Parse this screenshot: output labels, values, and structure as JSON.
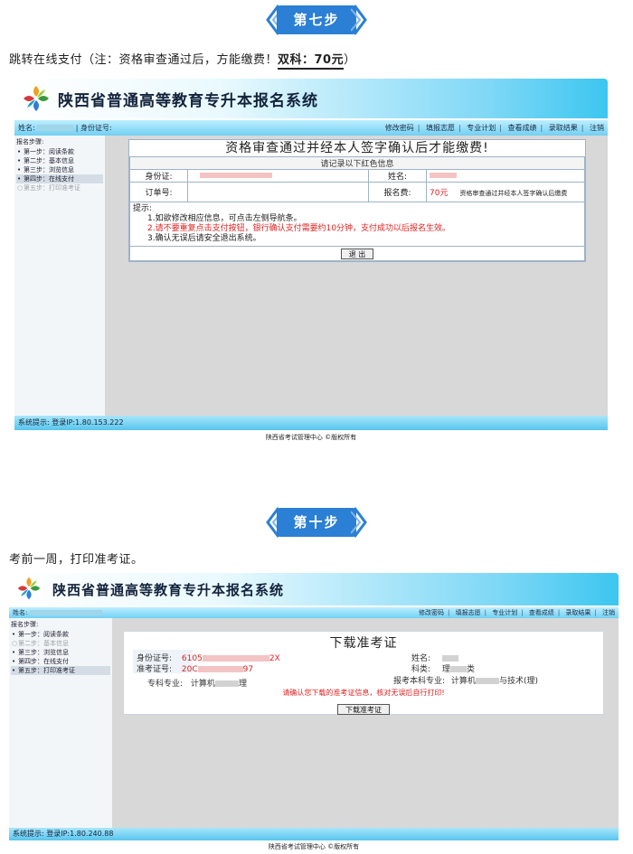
{
  "step7": {
    "badge": "第七步",
    "instruction": "跳转在线支付（注：资格审查通过后，方能缴费！",
    "fee_label": "双科：70元",
    "close_paren": "）",
    "screenshot": {
      "site_title": "陕西省普通高等教育专升本报名系统",
      "user_label": "姓名:",
      "id_label": "| 身份证号:",
      "nav_links": [
        "修改密码",
        "填报志愿",
        "专业计划",
        "查看成绩",
        "录取结果",
        "注销"
      ],
      "sidebar_header": "报名步骤:",
      "sidebar_steps": [
        {
          "label": "第一步：阅读条款",
          "state": "normal"
        },
        {
          "label": "第二步：基本信息",
          "state": "normal"
        },
        {
          "label": "第三步：浏览信息",
          "state": "normal"
        },
        {
          "label": "第四步：在线支付",
          "state": "active"
        },
        {
          "label": "第五步：打印准考证",
          "state": "dim"
        }
      ],
      "card_title": "资格审查通过并经本人签字确认后才能缴费!",
      "card_subtitle": "请记录以下红色信息",
      "id_field_label": "身份证:",
      "name_field_label": "姓名:",
      "order_field_label": "订单号:",
      "fee_field_label": "报名费:",
      "fee_value": "70元",
      "fee_note": "资格审查通过并经本人签字确认后缴费",
      "tips_header": "提示:",
      "tips": [
        "1.如欲修改相应信息，可点击左侧导航条。",
        "2.请不要重复点击支付按钮，银行确认支付需要约10分钟，支付成功以后报名生效。",
        "3.确认无误后请安全退出系统。"
      ],
      "exit_button": "退 出",
      "status_text": "系统提示: 登录IP:1.80.153.222",
      "footer_text": "陕西省考试管理中心 ©版权所有"
    }
  },
  "step10": {
    "badge": "第十步",
    "instruction": "考前一周，打印准考证。",
    "screenshot": {
      "site_title": "陕西省普通高等教育专升本报名系统",
      "user_label": "姓名:",
      "nav_links": [
        "修改密码",
        "填报志愿",
        "专业计划",
        "查看成绩",
        "录取结果",
        "注销"
      ],
      "sidebar_header": "报名步骤:",
      "sidebar_steps": [
        {
          "label": "第一步：阅读条款",
          "state": "normal"
        },
        {
          "label": "第二步：基本信息",
          "state": "dim"
        },
        {
          "label": "第三步：浏览信息",
          "state": "normal"
        },
        {
          "label": "第四步：在线支付",
          "state": "normal"
        },
        {
          "label": "第五步：打印准考证",
          "state": "active"
        }
      ],
      "card_title": "下载准考证",
      "id_label": "身份证号:",
      "id_value_start": "6105",
      "id_value_end": "2X",
      "exam_no_label": "准考证号:",
      "exam_no_start": "20C",
      "exam_no_end": "97",
      "name_label": "姓名:",
      "category_label": "科类:",
      "category_value": "理",
      "category_value_end": "类",
      "major_label": "专科专业:",
      "major_value": "计算机",
      "major_value_end": "理",
      "target_major_label": "报考本科专业:",
      "target_major_value": "计算机",
      "target_major_value_end": "与技术(理)",
      "note": "请确认您下载的准考证信息，核对无误后自行打印!",
      "download_button": "下载准考证",
      "status_text": "系统提示: 登录IP:1.80.240.88",
      "footer_text": "陕西省考试管理中心 ©版权所有"
    }
  }
}
